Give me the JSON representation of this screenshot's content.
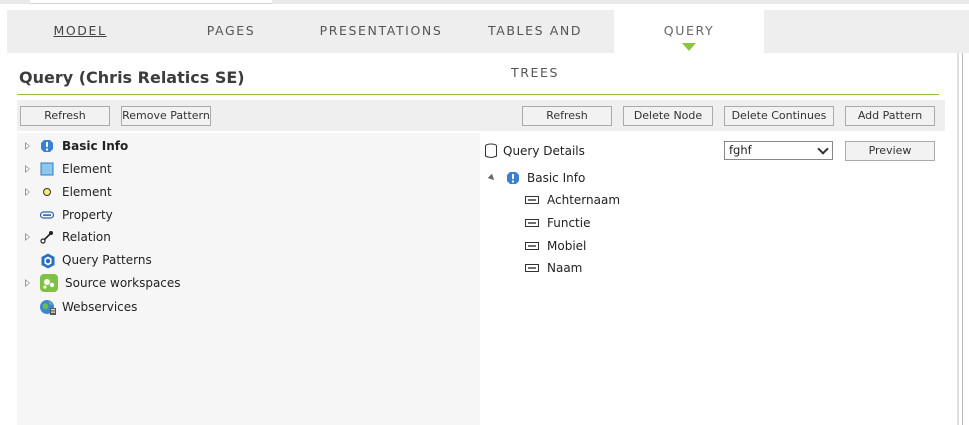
{
  "tabs": [
    {
      "label": "MODEL"
    },
    {
      "label": "PAGES"
    },
    {
      "label": "PRESENTATIONS"
    },
    {
      "label": "TABLES AND TREES"
    },
    {
      "label": "QUERY"
    }
  ],
  "active_tab": "QUERY",
  "page_title": "Query (Chris Relatics SE)",
  "left_toolbar": {
    "refresh_label": "Refresh",
    "remove_pattern_label": "Remove Pattern"
  },
  "right_toolbar": {
    "refresh_label": "Refresh",
    "delete_node_label": "Delete Node",
    "delete_continues_label": "Delete Continues",
    "add_pattern_label": "Add Pattern"
  },
  "left_tree": [
    {
      "label": "Basic Info",
      "icon": "exclamation-icon",
      "expandable": true,
      "bold": true
    },
    {
      "label": "Element",
      "icon": "square-icon",
      "expandable": true,
      "bold": false
    },
    {
      "label": "Element",
      "icon": "circle-icon",
      "expandable": true,
      "bold": false
    },
    {
      "label": "Property",
      "icon": "property-icon",
      "expandable": false,
      "bold": false
    },
    {
      "label": "Relation",
      "icon": "relation-icon",
      "expandable": true,
      "bold": false
    },
    {
      "label": "Query Patterns",
      "icon": "hexagon-icon",
      "expandable": false,
      "bold": false
    },
    {
      "label": "Source workspaces",
      "icon": "workspace-icon",
      "expandable": true,
      "bold": false
    },
    {
      "label": "Webservices",
      "icon": "globe-icon",
      "expandable": false,
      "bold": false
    }
  ],
  "query_details": {
    "label": "Query Details",
    "selected_value": "fghf",
    "preview_label": "Preview"
  },
  "query_tree": {
    "root_label": "Basic Info",
    "children": [
      "Achternaam",
      "Functie",
      "Mobiel",
      "Naam"
    ]
  },
  "colors": {
    "accent": "#8cc63f",
    "toolbar_bg": "#efefef",
    "panel_bg": "#f6f6f6"
  }
}
